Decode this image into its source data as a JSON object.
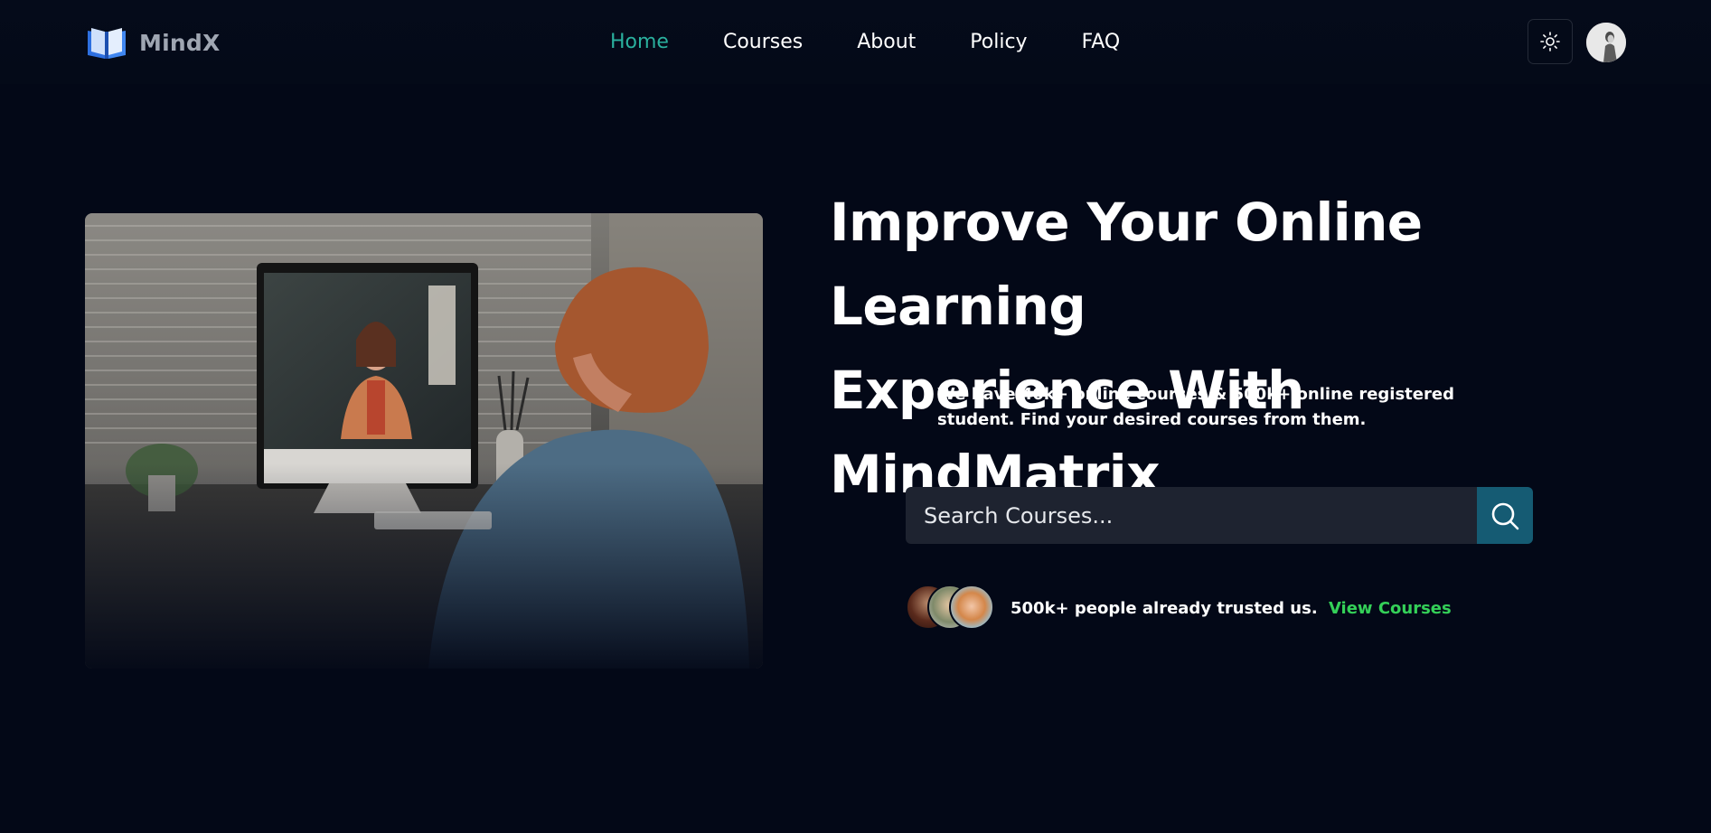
{
  "brand": {
    "name": "MindX",
    "logo_icon": "open-book-icon",
    "logo_color": "#2d6fe0"
  },
  "nav": {
    "items": [
      {
        "label": "Home",
        "active": true
      },
      {
        "label": "Courses",
        "active": false
      },
      {
        "label": "About",
        "active": false
      },
      {
        "label": "Policy",
        "active": false
      },
      {
        "label": "FAQ",
        "active": false
      }
    ],
    "active_color": "#2ab09e"
  },
  "header_actions": {
    "theme_toggle_icon": "sun-icon",
    "avatar_icon": "user-avatar"
  },
  "hero": {
    "image_description_icon": "child-video-call-photo",
    "title_line1": "Improve Your Online Learning",
    "title_line2": "Experience With MindMatrix",
    "description": "We have 40k+ online courses & 500k+ online registered student. Find your desired courses from them.",
    "search": {
      "placeholder": "Search Courses...",
      "button_icon": "search-icon",
      "button_color": "#155b73"
    },
    "trust": {
      "text": "500k+ people already trusted us.",
      "link_label": "View Courses",
      "link_color": "#34d058"
    }
  },
  "colors": {
    "background": "#030817",
    "input_bg": "#1e2330"
  }
}
